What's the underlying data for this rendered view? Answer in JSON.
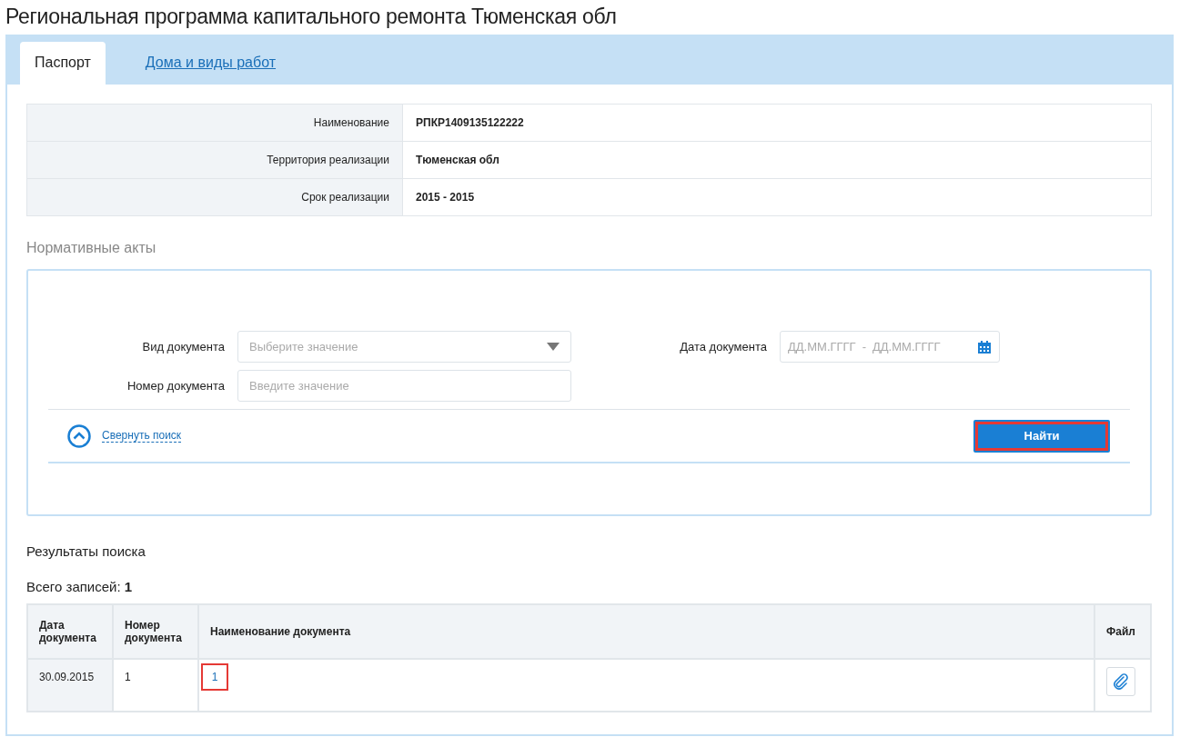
{
  "page": {
    "title": "Региональная программа капитального ремонта Тюменская обл"
  },
  "tabs": [
    {
      "label": "Паспорт",
      "selected": true
    },
    {
      "label": "Дома и виды работ",
      "selected": false
    }
  ],
  "passport": [
    {
      "label": "Наименование",
      "value": "РПКР1409135122222"
    },
    {
      "label": "Территория реализации",
      "value": "Тюменская обл"
    },
    {
      "label": "Срок реализации",
      "value": "2015  - 2015"
    }
  ],
  "acts": {
    "title": "Нормативные акты",
    "fields": [
      {
        "kind": "select",
        "label": "Вид документа",
        "placeholder": "Выберите значение"
      },
      {
        "kind": "text",
        "label": "Номер документа",
        "placeholder": "Введите значение"
      },
      {
        "kind": "daterange",
        "label": "Дата документа",
        "placeholder_from": "ДД.ММ.ГГГГ",
        "separator": "-",
        "placeholder_to": "ДД.ММ.ГГГГ"
      }
    ],
    "collapse_link": "Свернуть поиск",
    "find_button": {
      "label": "Найти",
      "highlighted": true
    }
  },
  "results": {
    "title": "Результаты поиска",
    "total_label": "Всего записей:",
    "total": "1",
    "table": {
      "columns": [
        "Дата документа",
        "Номер документа",
        "Наименование документа",
        "Файл"
      ],
      "rows": [
        {
          "date": "30.09.2015",
          "number": "1",
          "name": "1",
          "name_highlighted": true
        }
      ]
    }
  }
}
